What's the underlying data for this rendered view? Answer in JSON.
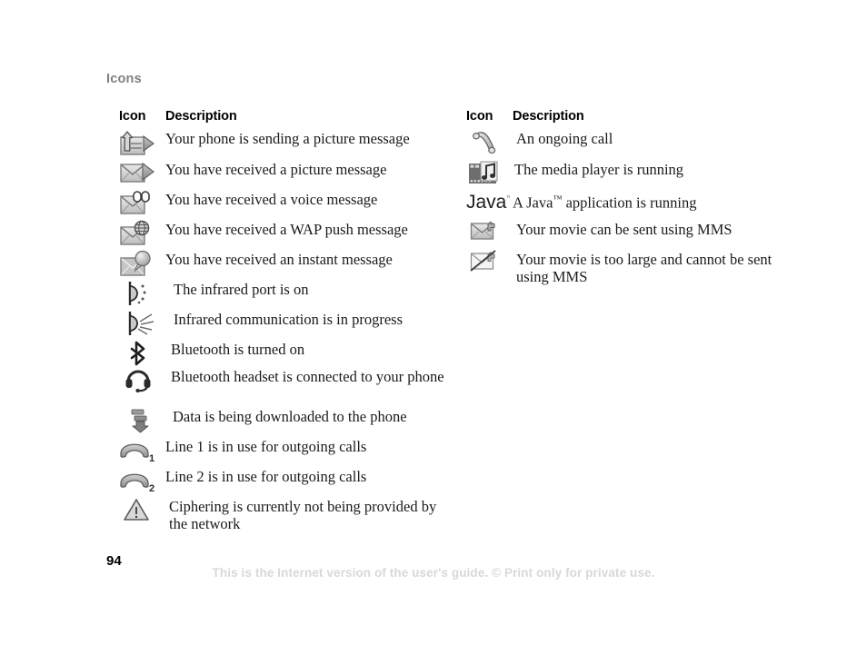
{
  "document": {
    "section_heading": "Icons",
    "page_number": "94",
    "footer_note": "This is the Internet version of the user's guide. © Print only for private use."
  },
  "columns": {
    "left": {
      "header_icon": "Icon",
      "header_description": "Description",
      "rows": [
        {
          "icon": "sending-picture-message-icon",
          "text": "Your phone is sending a picture message"
        },
        {
          "icon": "received-picture-message-icon",
          "text": "You have received a picture message"
        },
        {
          "icon": "received-voice-message-icon",
          "text": "You have received a voice message"
        },
        {
          "icon": "received-wap-push-message-icon",
          "text": "You have received a WAP push message"
        },
        {
          "icon": "received-instant-message-icon",
          "text": "You have received an instant message"
        },
        {
          "icon": "infrared-port-on-icon",
          "text": "The infrared port is on"
        },
        {
          "icon": "infrared-communication-icon",
          "text": "Infrared communication is in progress"
        },
        {
          "icon": "bluetooth-on-icon",
          "text": "Bluetooth is turned on"
        },
        {
          "icon": "bluetooth-headset-icon",
          "text": "Bluetooth headset is connected to your phone"
        },
        {
          "icon": "data-download-icon",
          "text": "Data is being downloaded to the phone"
        },
        {
          "icon": "line-1-outgoing-icon",
          "text": "Line 1 is in use for outgoing calls"
        },
        {
          "icon": "line-2-outgoing-icon",
          "text": "Line 2 is in use for outgoing calls"
        },
        {
          "icon": "no-ciphering-warning-icon",
          "text": "Ciphering is currently not being provided by the network"
        }
      ]
    },
    "right": {
      "header_icon": "Icon",
      "header_description": "Description",
      "rows": [
        {
          "icon": "ongoing-call-icon",
          "text": "An ongoing call"
        },
        {
          "icon": "media-player-running-icon",
          "text": "The media player is running"
        },
        {
          "icon": "java-application-icon",
          "text_before_tm": "A Java",
          "text_after_tm": " application is running",
          "tm": "™"
        },
        {
          "icon": "movie-sendable-mms-icon",
          "text": "Your movie can be sent using MMS"
        },
        {
          "icon": "movie-too-large-mms-icon",
          "text": "Your movie is too large and cannot be sent using MMS"
        }
      ]
    }
  },
  "colors": {
    "heading_gray": "#808080",
    "body_text": "#1a1a1a",
    "footer_gray": "#d8d8d8",
    "icon_dark": "#4a4a4a",
    "icon_mid": "#8c8c8c",
    "icon_light": "#d0d0d0"
  }
}
